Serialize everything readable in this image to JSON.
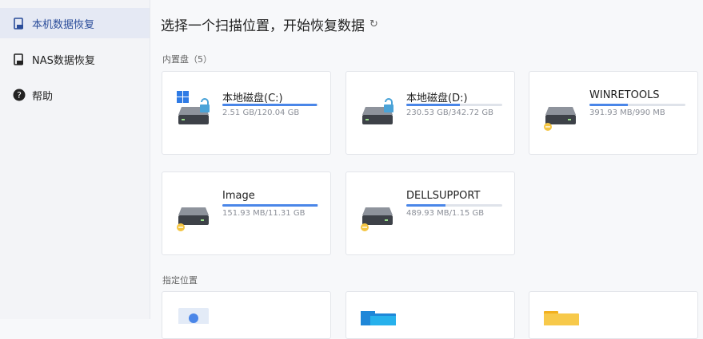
{
  "sidebar": {
    "items": [
      {
        "label": "本机数据恢复",
        "icon": "local-recovery-icon"
      },
      {
        "label": "NAS数据恢复",
        "icon": "nas-recovery-icon"
      },
      {
        "label": "帮助",
        "icon": "help-icon"
      }
    ]
  },
  "header": {
    "title": "选择一个扫描位置，开始恢复数据",
    "refresh_icon": "refresh-icon"
  },
  "sections": {
    "internal": "内置盘（5）",
    "specified": "指定位置"
  },
  "drives": [
    {
      "name": "本地磁盘(C:)",
      "size": "2.51 GB/120.04 GB",
      "usage": 0.98,
      "windows": true,
      "locked": true
    },
    {
      "name": "本地磁盘(D:)",
      "size": "230.53 GB/342.72 GB",
      "usage": 0.56,
      "windows": false,
      "locked": true
    },
    {
      "name": "WINRETOOLS",
      "size": "391.93 MB/990 MB",
      "usage": 0.4,
      "windows": false,
      "locked": false
    },
    {
      "name": "Image",
      "size": "151.93 MB/11.31 GB",
      "usage": 0.99,
      "windows": false,
      "locked": false
    },
    {
      "name": "DELLSUPPORT",
      "size": "489.93 MB/1.15 GB",
      "usage": 0.41,
      "windows": false,
      "locked": false
    }
  ],
  "colors": {
    "accent": "#4a86e8",
    "lock": "#4aa3d8",
    "badge": "#f4c542"
  }
}
